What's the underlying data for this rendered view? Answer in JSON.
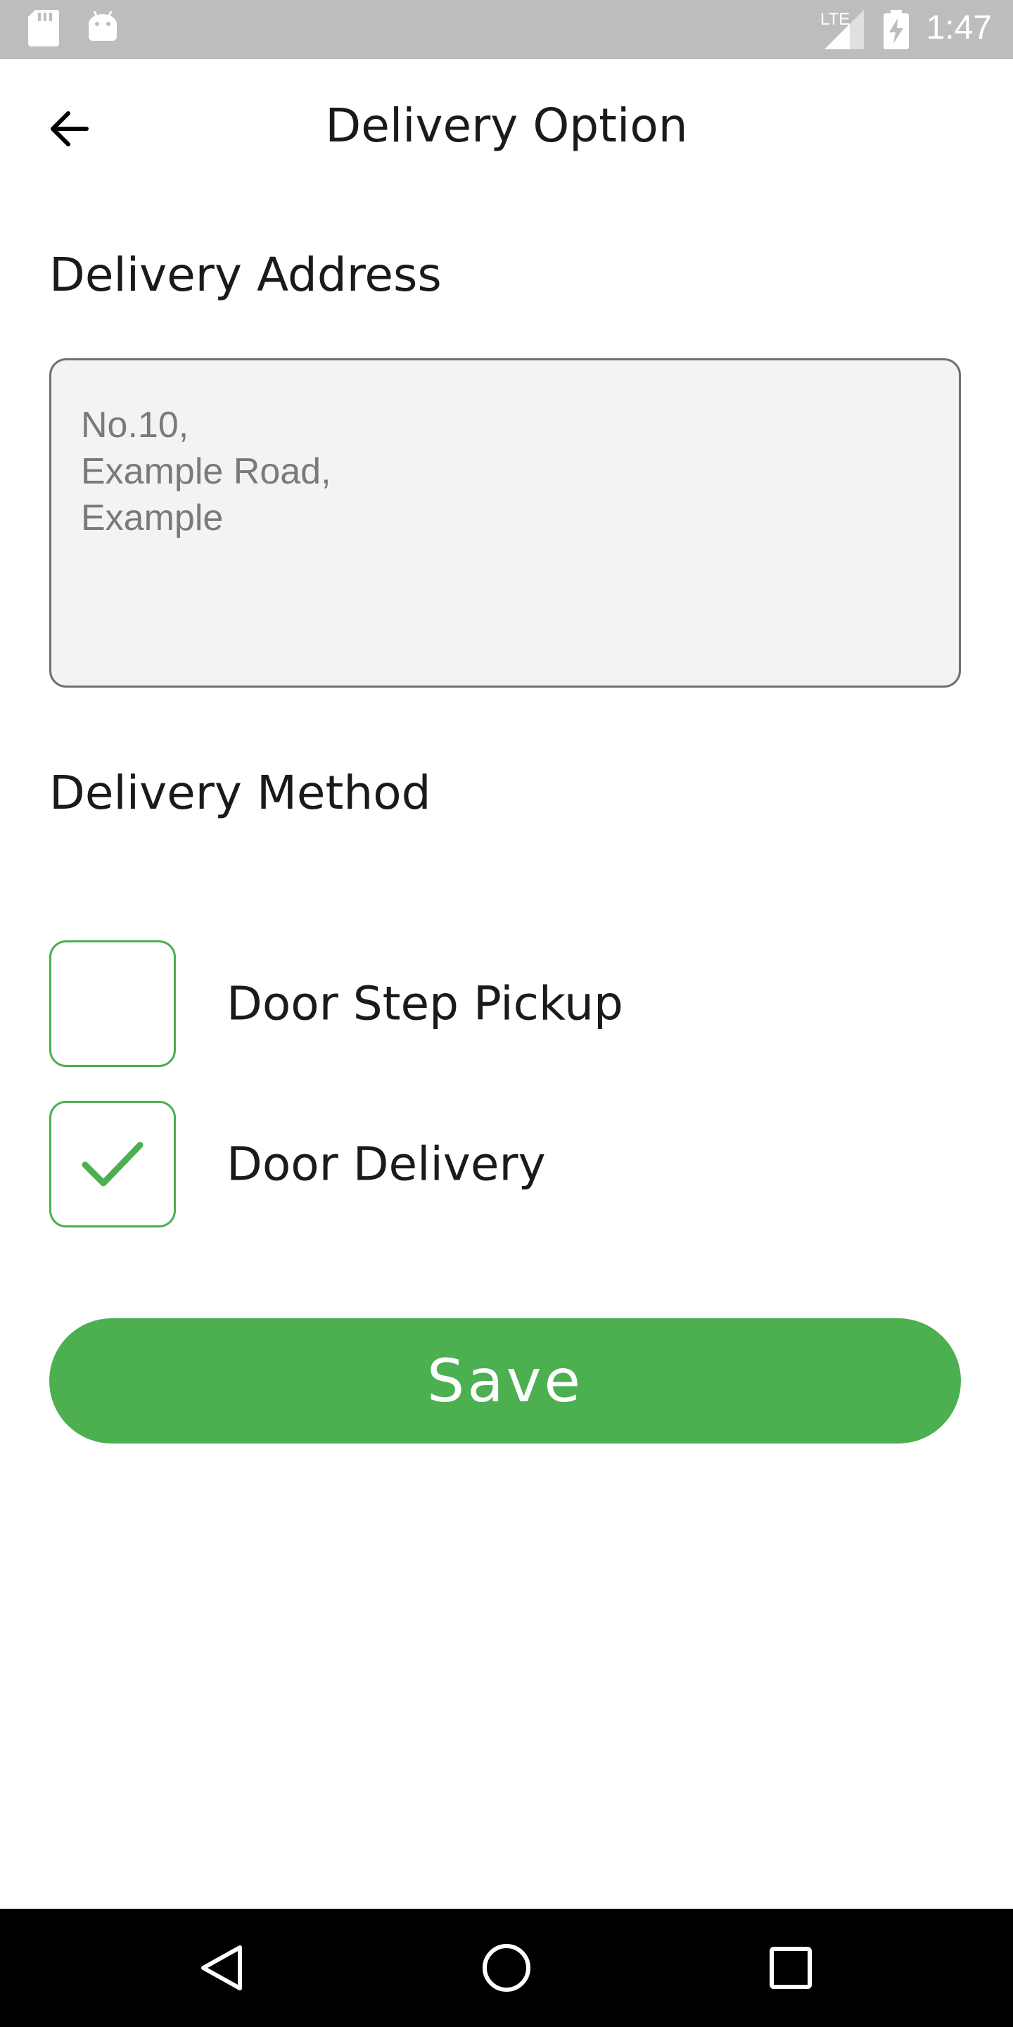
{
  "status_bar": {
    "time": "1:47",
    "network_label": "LTE",
    "icons": [
      "sd-card-icon",
      "android-icon",
      "signal-icon",
      "battery-charging-icon"
    ]
  },
  "app_bar": {
    "title": "Delivery Option",
    "back_icon": "arrow-left-icon"
  },
  "address": {
    "label": "Delivery Address",
    "lines": [
      "No.10,",
      "Example Road,",
      "Example"
    ]
  },
  "method": {
    "label": "Delivery Method",
    "options": [
      {
        "label": "Door Step Pickup",
        "checked": false
      },
      {
        "label": "Door Delivery",
        "checked": true
      }
    ]
  },
  "save_label": "Save",
  "colors": {
    "accent": "#4caf50",
    "status_bar": "#bdbdbd",
    "nav_bar": "#000000",
    "field_bg": "#f3f3f3"
  },
  "nav_bar": {
    "icons": [
      "back-triangle-icon",
      "home-circle-icon",
      "recents-square-icon"
    ]
  }
}
